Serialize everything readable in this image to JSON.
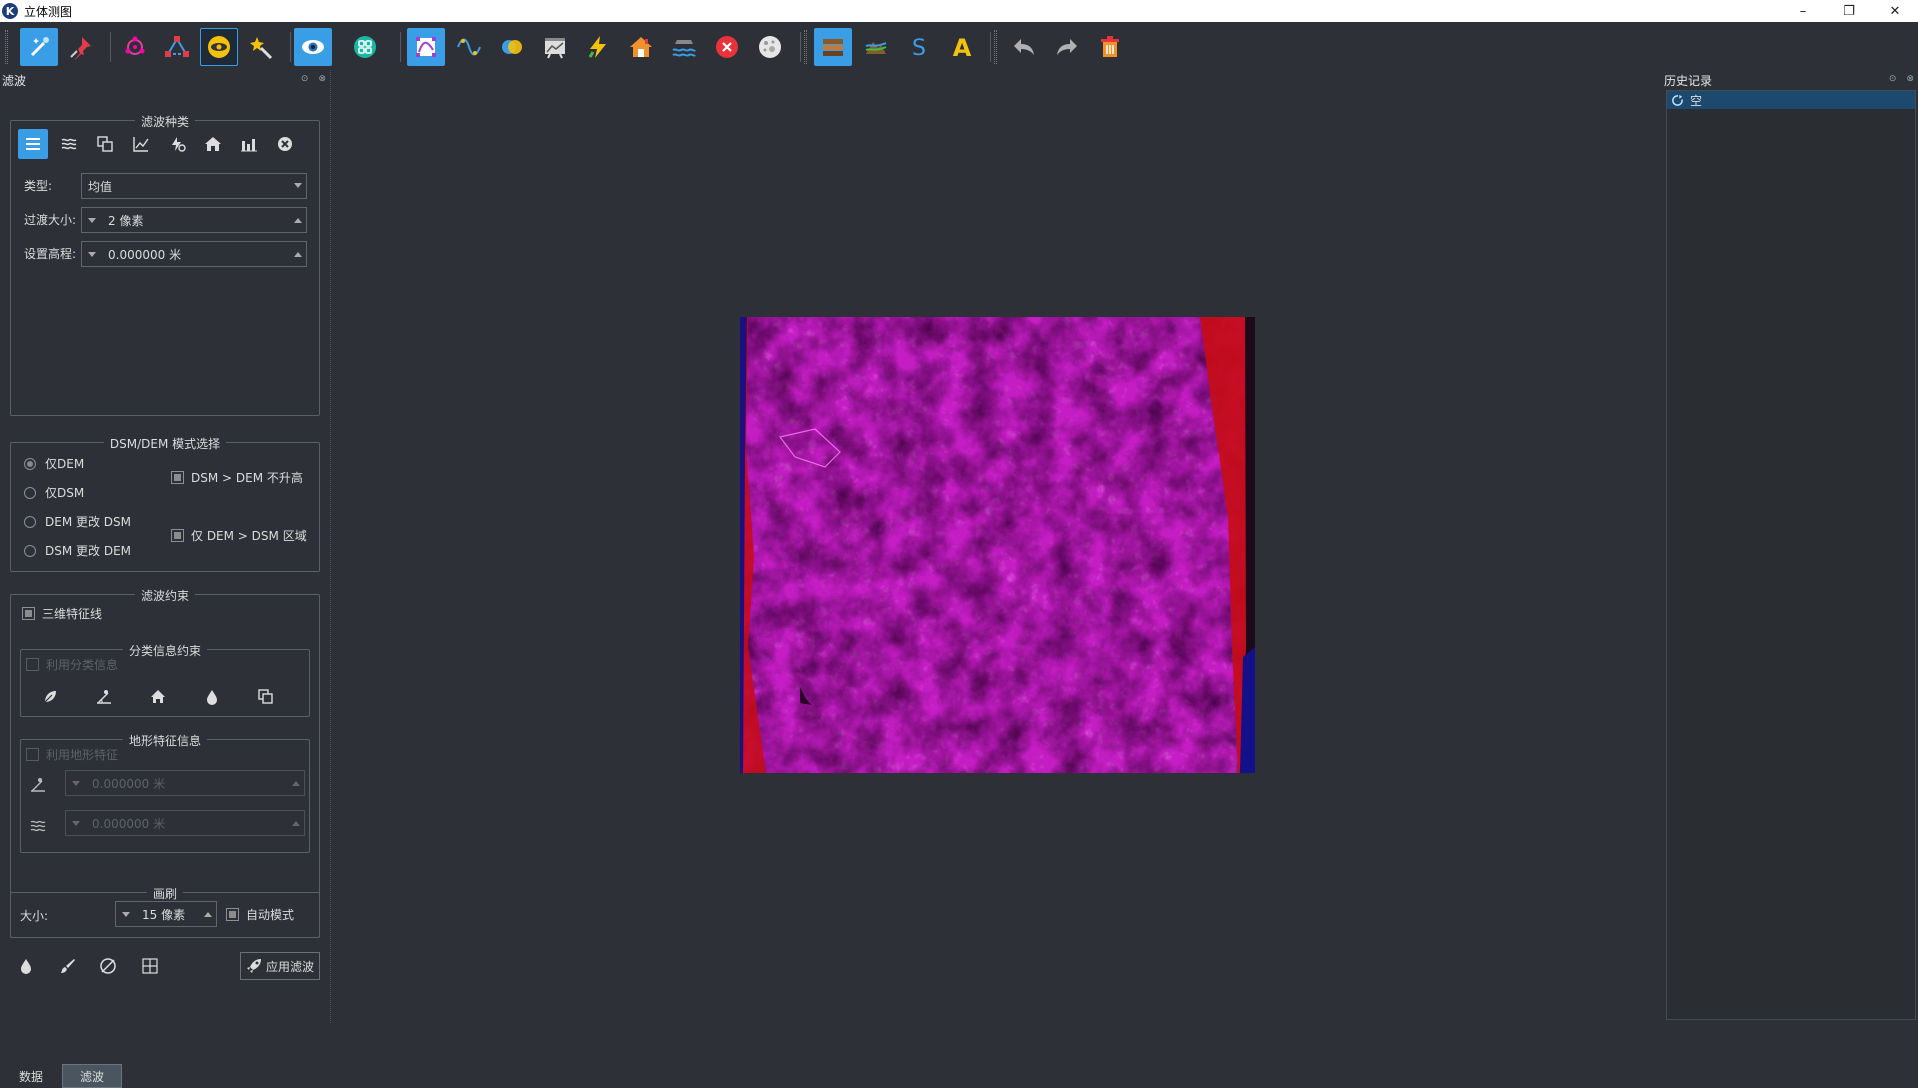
{
  "window": {
    "title": "立体测图",
    "logo": "K",
    "minimize": "–",
    "restore": "❐",
    "close": "✕"
  },
  "toolbar": {
    "icons": [
      "magic-wand-icon",
      "pin-icon",
      "network-icon",
      "node-edit-icon",
      "eye-yellow-icon",
      "star-tool-icon",
      "eye-view-icon",
      "grid-color-icon",
      "curve-select-icon",
      "wave-icon",
      "color-blend-icon",
      "chart-window-icon",
      "lightning-icon",
      "house-icon",
      "water-icon",
      "close-red-icon",
      "moon-icon",
      "layers-brown-icon",
      "terrain-icon",
      "s-letter-icon",
      "a-letter-icon",
      "undo-icon",
      "redo-icon",
      "trash-icon"
    ]
  },
  "left_panel": {
    "title": "滤波",
    "filter_type": {
      "title": "滤波种类",
      "icons": [
        "list-icon",
        "waves-icon",
        "copy-icon",
        "chart-icon",
        "wind-icon",
        "home-icon",
        "bar-chart-icon",
        "close-circle-icon"
      ]
    },
    "type_label": "类型:",
    "type_value": "均值",
    "transition_label": "过渡大小:",
    "transition_value": "2 像素",
    "elevation_label": "设置高程:",
    "elevation_value": "0.000000 米",
    "mode": {
      "title": "DSM/DEM 模式选择",
      "options": [
        "仅DEM",
        "仅DSM",
        "DEM 更改 DSM",
        "DSM 更改 DEM"
      ],
      "selected": "仅DEM",
      "check1": "DSM > DEM 不升高",
      "check2": "仅 DEM > DSM 区域"
    },
    "constraint": {
      "title": "滤波约束",
      "feature_line": "三维特征线",
      "class_title": "分类信息约束",
      "use_class": "利用分类信息",
      "terrain_title": "地形特征信息",
      "use_terrain": "利用地形特征",
      "terrain_value1": "0.000000 米",
      "terrain_value2": "0.000000 米"
    },
    "brush": {
      "title": "画刷",
      "size_label": "大小:",
      "size_value": "15 像素",
      "auto_mode": "自动模式"
    },
    "apply_button": "应用滤波",
    "tabs": [
      "数据",
      "滤波"
    ]
  },
  "right_panel": {
    "title": "历史记录",
    "items": [
      "空"
    ]
  },
  "colors": {
    "accent": "#3a9ee6",
    "background": "#2d3137",
    "image_magenta": "#c41dc4",
    "image_red": "#c80c14"
  }
}
